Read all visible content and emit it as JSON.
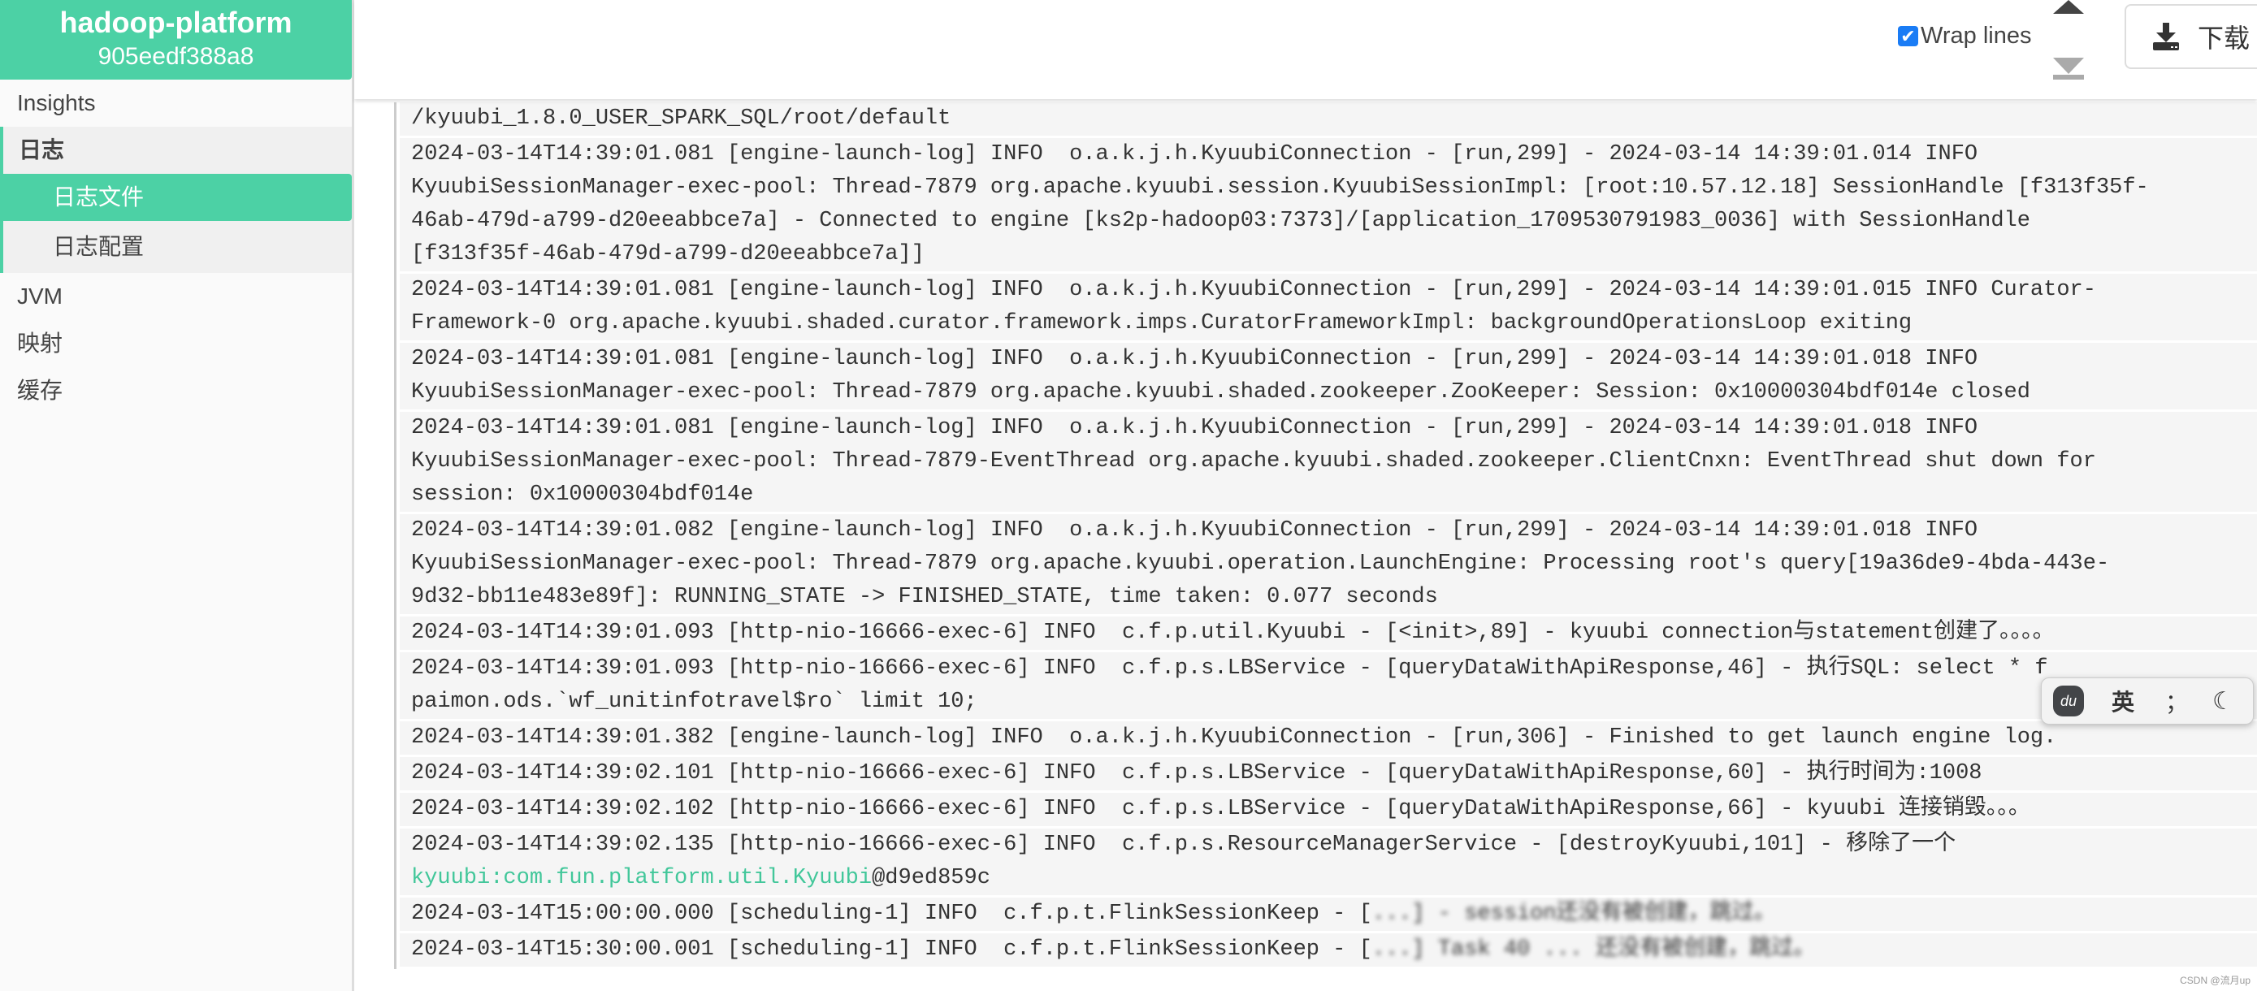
{
  "sidebar": {
    "app_name": "hadoop-platform",
    "instance_id": "905eedf388a8",
    "items": {
      "insights": "Insights",
      "logs": "日志",
      "log_files": "日志文件",
      "log_config": "日志配置",
      "jvm": "JVM",
      "mappings": "映射",
      "cache": "缓存"
    },
    "active": "日志文件"
  },
  "toolbar": {
    "wrap_lines_label": "Wrap lines",
    "wrap_lines_checked": true,
    "download_label": "下载",
    "scroll_top_icon": "triangle-up-icon",
    "scroll_bottom_icon": "arrow-to-bottom-icon",
    "download_icon": "download-icon"
  },
  "log": {
    "entries": [
      {
        "lines": [
          "/kyuubi_1.8.0_USER_SPARK_SQL/root/default"
        ]
      },
      {
        "lines": [
          "2024-03-14T14:39:01.081 [engine-launch-log] INFO  o.a.k.j.h.KyuubiConnection - [run,299] - 2024-03-14 14:39:01.014 INFO",
          "KyuubiSessionManager-exec-pool: Thread-7879 org.apache.kyuubi.session.KyuubiSessionImpl: [root:10.57.12.18] SessionHandle [f313f35f-",
          "46ab-479d-a799-d20eeabbce7a] - Connected to engine [ks2p-hadoop03:7373]/[application_1709530791983_0036] with SessionHandle",
          "[f313f35f-46ab-479d-a799-d20eeabbce7a]]"
        ]
      },
      {
        "lines": [
          "2024-03-14T14:39:01.081 [engine-launch-log] INFO  o.a.k.j.h.KyuubiConnection - [run,299] - 2024-03-14 14:39:01.015 INFO Curator-",
          "Framework-0 org.apache.kyuubi.shaded.curator.framework.imps.CuratorFrameworkImpl: backgroundOperationsLoop exiting"
        ]
      },
      {
        "lines": [
          "2024-03-14T14:39:01.081 [engine-launch-log] INFO  o.a.k.j.h.KyuubiConnection - [run,299] - 2024-03-14 14:39:01.018 INFO",
          "KyuubiSessionManager-exec-pool: Thread-7879 org.apache.kyuubi.shaded.zookeeper.ZooKeeper: Session: 0x10000304bdf014e closed"
        ]
      },
      {
        "lines": [
          "2024-03-14T14:39:01.081 [engine-launch-log] INFO  o.a.k.j.h.KyuubiConnection - [run,299] - 2024-03-14 14:39:01.018 INFO",
          "KyuubiSessionManager-exec-pool: Thread-7879-EventThread org.apache.kyuubi.shaded.zookeeper.ClientCnxn: EventThread shut down for",
          "session: 0x10000304bdf014e"
        ]
      },
      {
        "lines": [
          "2024-03-14T14:39:01.082 [engine-launch-log] INFO  o.a.k.j.h.KyuubiConnection - [run,299] - 2024-03-14 14:39:01.018 INFO",
          "KyuubiSessionManager-exec-pool: Thread-7879 org.apache.kyuubi.operation.LaunchEngine: Processing root's query[19a36de9-4bda-443e-",
          "9d32-bb11e483e89f]: RUNNING_STATE -> FINISHED_STATE, time taken: 0.077 seconds"
        ]
      },
      {
        "lines": [
          "2024-03-14T14:39:01.093 [http-nio-16666-exec-6] INFO  c.f.p.util.Kyuubi - [<init>,89] - kyuubi connection与statement创建了。。。。"
        ]
      },
      {
        "lines": [
          "2024-03-14T14:39:01.093 [http-nio-16666-exec-6] INFO  c.f.p.s.LBService - [queryDataWithApiResponse,46] - 执行SQL: select * f",
          "paimon.ods.`wf_unitinfotravel$ro` limit 10;"
        ]
      },
      {
        "lines": [
          "2024-03-14T14:39:01.382 [engine-launch-log] INFO  o.a.k.j.h.KyuubiConnection - [run,306] - Finished to get launch engine log."
        ]
      },
      {
        "lines": [
          "2024-03-14T14:39:02.101 [http-nio-16666-exec-6] INFO  c.f.p.s.LBService - [queryDataWithApiResponse,60] - 执行时间为:1008"
        ]
      },
      {
        "lines": [
          "2024-03-14T14:39:02.102 [http-nio-16666-exec-6] INFO  c.f.p.s.LBService - [queryDataWithApiResponse,66] - kyuubi 连接销毁。。。"
        ]
      },
      {
        "lines": [
          "2024-03-14T14:39:02.135 [http-nio-16666-exec-6] INFO  c.f.p.s.ResourceManagerService - [destroyKyuubi,101] - 移除了一个"
        ],
        "link": "kyuubi:com.fun.platform.util.Kyuubi",
        "link_suffix": "@d9ed859c"
      },
      {
        "lines": [
          "2024-03-14T15:00:00.000 [scheduling-1] INFO  c.f.p.t.FlinkSessionKeep - ["
        ],
        "redacted": "...] - session还没有被创建，跳过。"
      },
      {
        "lines": [
          "2024-03-14T15:30:00.001 [scheduling-1] INFO  c.f.p.t.FlinkSessionKeep - ["
        ],
        "redacted": "...] Task 40 ... 还没有被创建，跳过。"
      }
    ],
    "link_color": "#42c79a"
  },
  "ime": {
    "logo": "du",
    "mode": "英",
    "punct": "；",
    "theme_icon": "moon-icon"
  },
  "watermark": "CSDN @流月up",
  "colors": {
    "accent": "#4cd1a5",
    "checkbox": "#1a7cf5"
  }
}
